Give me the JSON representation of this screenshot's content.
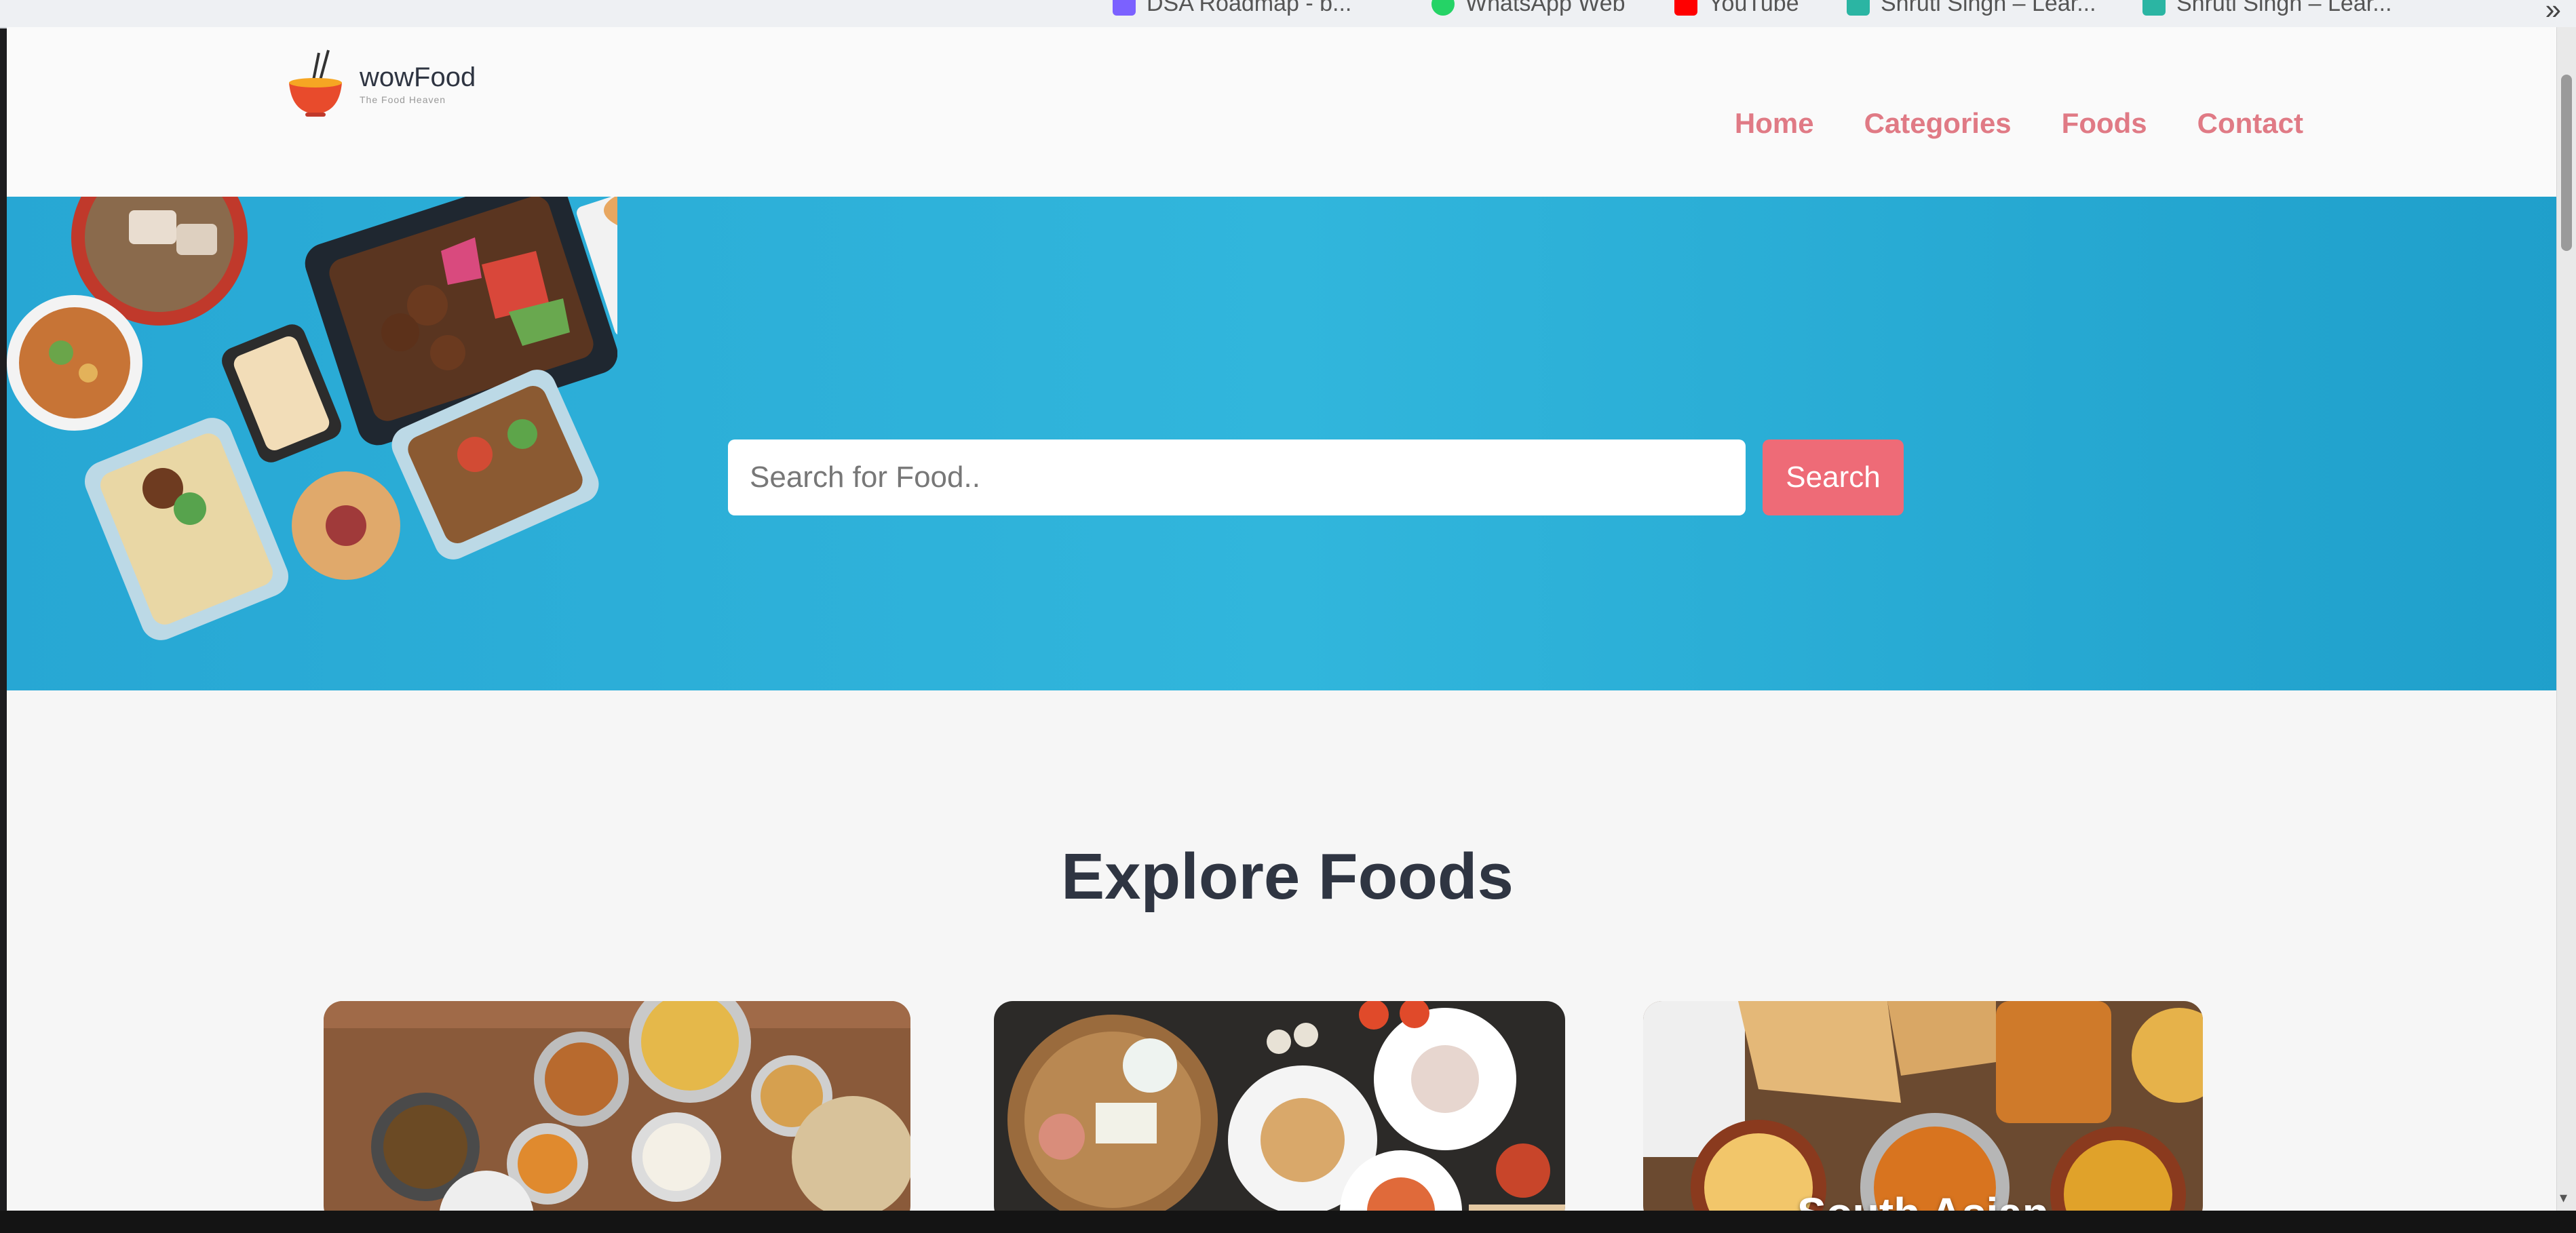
{
  "browser": {
    "bookmarks": [
      {
        "label": "DSA Roadmap - b...",
        "icon": "roadmap-icon",
        "color": "#7b61ff"
      },
      {
        "label": "WhatsApp Web",
        "icon": "whatsapp-icon",
        "color": "#25d366"
      },
      {
        "label": "YouTube",
        "icon": "youtube-icon",
        "color": "#ff0000"
      },
      {
        "label": "Shruti Singh – Lear...",
        "icon": "bookmark-site-icon",
        "color": "#2bb5a3"
      },
      {
        "label": "Shruti Singh – Lear...",
        "icon": "bookmark-site-icon",
        "color": "#2bb5a3"
      }
    ],
    "overflow": "»"
  },
  "header": {
    "brand": "wowFood",
    "tagline": "The Food Heaven",
    "nav": [
      {
        "label": "Home"
      },
      {
        "label": "Categories"
      },
      {
        "label": "Foods"
      },
      {
        "label": "Contact"
      }
    ],
    "nav_color": "#e07a85"
  },
  "hero": {
    "background_color": "#2aaad6",
    "search": {
      "placeholder": "Search for Food..",
      "value": ""
    },
    "search_button": "Search",
    "button_color": "#ee6b77"
  },
  "explore": {
    "title": "Explore Foods",
    "cards": [
      {
        "label": "",
        "image": "indian-thali-image"
      },
      {
        "label": "",
        "image": "platter-image"
      },
      {
        "label": "South Asian",
        "image": "south-asian-image"
      }
    ]
  }
}
